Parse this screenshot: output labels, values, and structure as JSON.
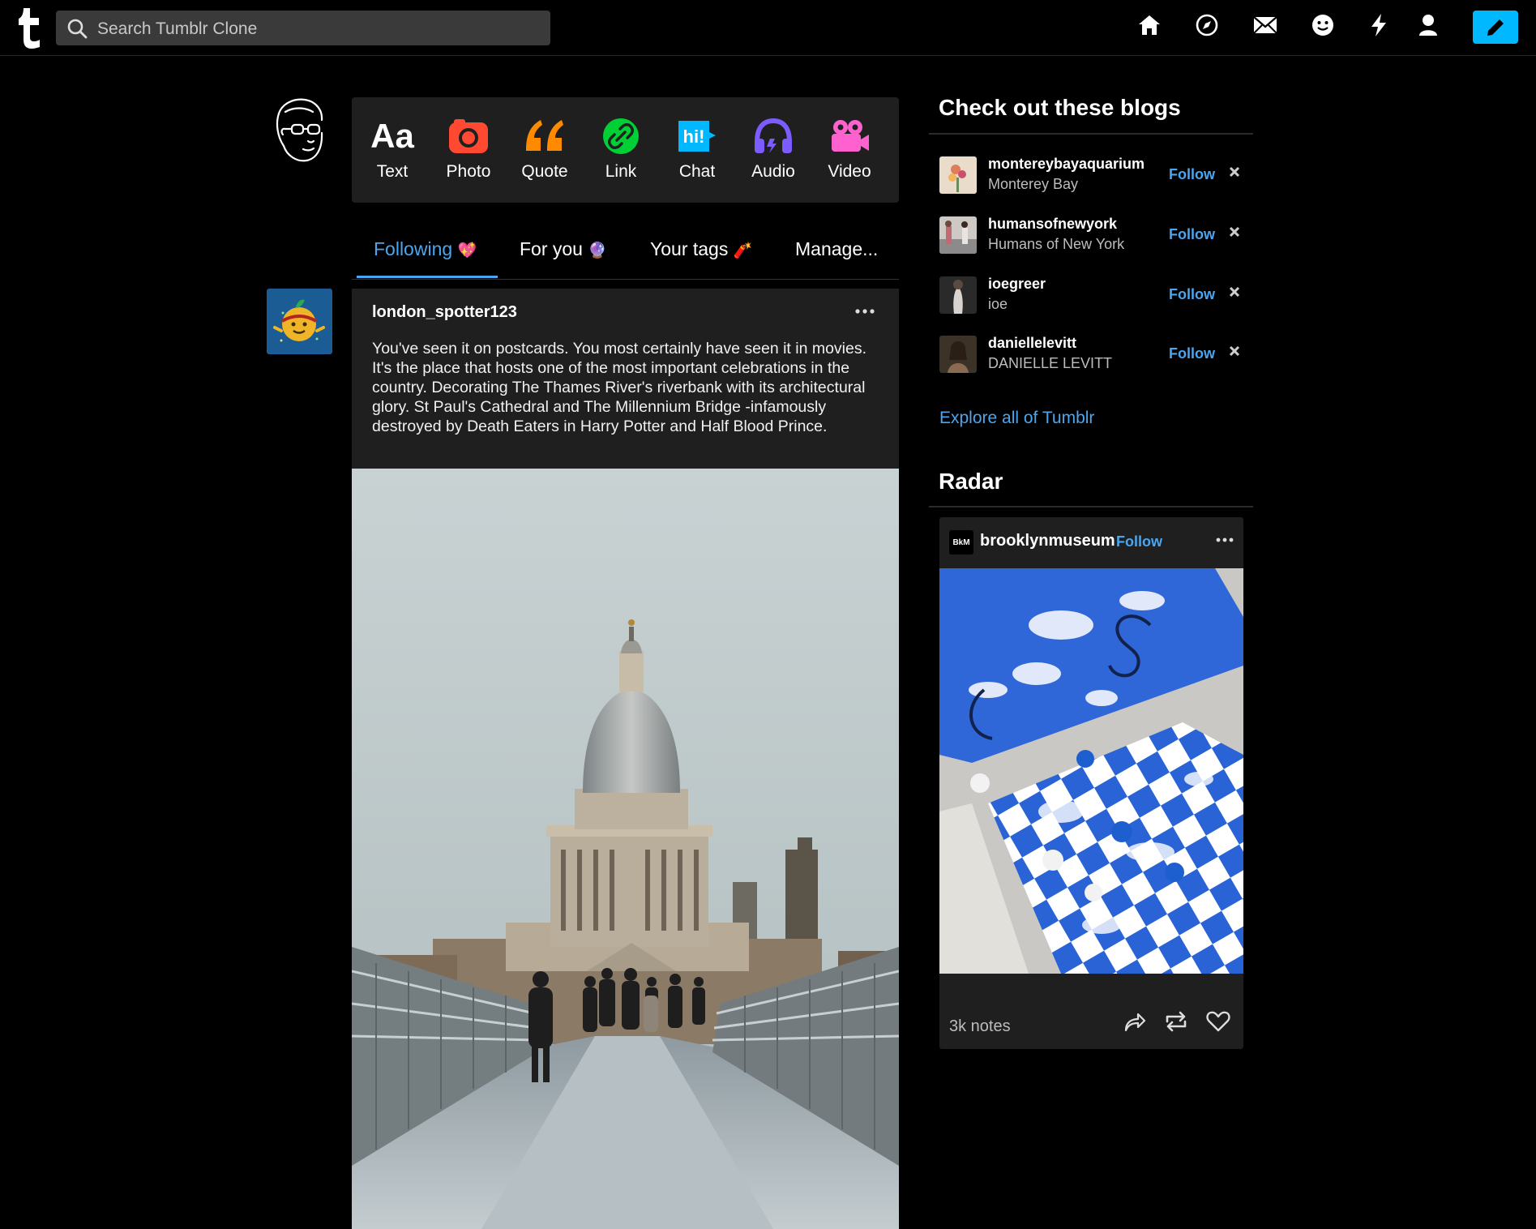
{
  "colors": {
    "accent": "#4aa6f0",
    "compose": "#00b8ff",
    "card": "#1f1f1f",
    "background": "#000000"
  },
  "search": {
    "placeholder": "Search Tumblr Clone"
  },
  "nav": {
    "icons": [
      "home-icon",
      "explore-icon",
      "inbox-icon",
      "messages-icon",
      "activity-icon",
      "account-icon",
      "compose-icon"
    ]
  },
  "post_types": [
    {
      "label": "Text",
      "icon": "Aa",
      "color": "#ffffff"
    },
    {
      "label": "Photo",
      "icon": "camera",
      "color": "#ff4930"
    },
    {
      "label": "Quote",
      "icon": "❝",
      "color": "#ff8a00"
    },
    {
      "label": "Link",
      "icon": "link",
      "color": "#00cf35"
    },
    {
      "label": "Chat",
      "icon": "hi!",
      "color": "#00b8ff"
    },
    {
      "label": "Audio",
      "icon": "headphones",
      "color": "#7c5cff"
    },
    {
      "label": "Video",
      "icon": "video-camera",
      "color": "#ff62ce"
    }
  ],
  "tabs": [
    {
      "label": "Following",
      "emoji": "💖",
      "active": true
    },
    {
      "label": "For you",
      "emoji": "🔮",
      "active": false
    },
    {
      "label": "Your tags",
      "emoji": "🧨",
      "active": false
    },
    {
      "label": "Manage...",
      "emoji": "",
      "active": false
    }
  ],
  "post": {
    "username": "london_spotter123",
    "text": "You've seen it on postcards. You most certainly have seen it in movies. It's the place that hosts one of the most important celebrations in the country. Decorating The Thames River's riverbank with its architectural glory. St Paul's Cathedral and The Millennium Bridge -infamously destroyed by Death Eaters in Harry Potter and Half Blood Prince."
  },
  "sidebar": {
    "blogs_heading": "Check out these blogs",
    "follow_label": "Follow",
    "blogs": [
      {
        "name": "montereybayaquarium",
        "title": "Monterey Bay"
      },
      {
        "name": "humansofnewyork",
        "title": "Humans of New York"
      },
      {
        "name": "ioegreer",
        "title": "ioe"
      },
      {
        "name": "daniellelevitt",
        "title": "DANIELLE LEVITT"
      }
    ],
    "explore_label": "Explore all of Tumblr",
    "radar_heading": "Radar",
    "radar": {
      "logo_text": "BkM",
      "blog": "brooklynmuseum",
      "follow_label": "Follow",
      "notes": "3k notes"
    }
  }
}
